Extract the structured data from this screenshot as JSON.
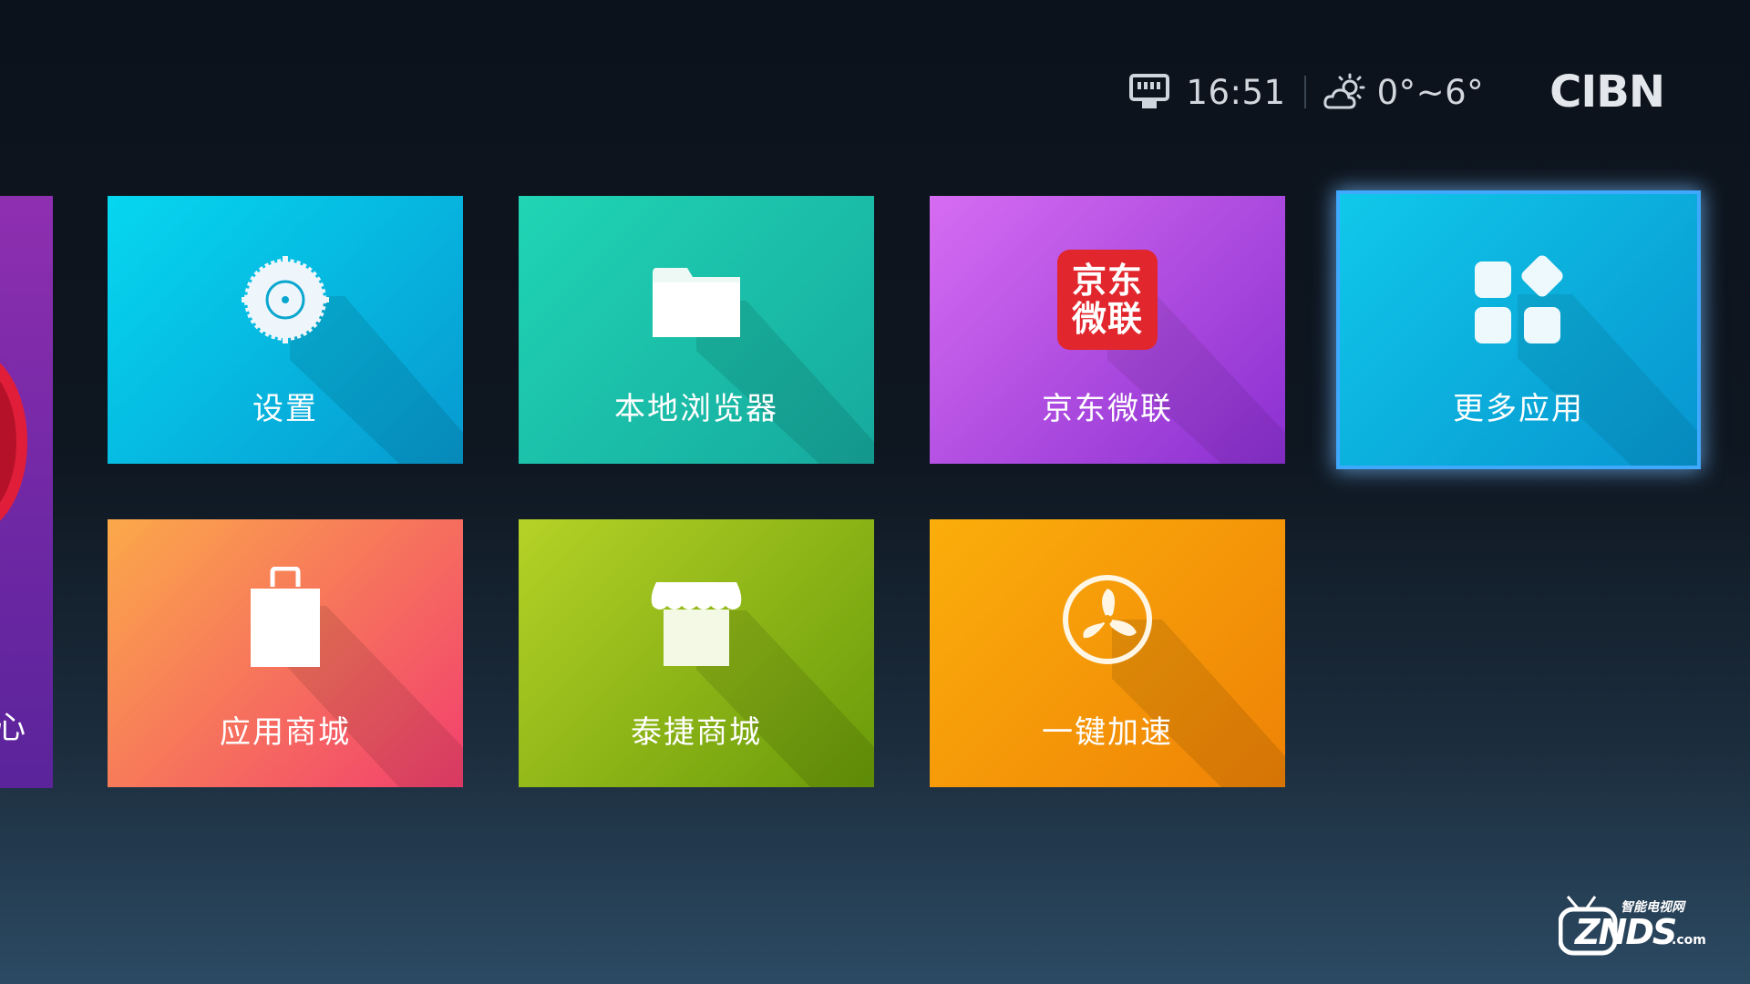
{
  "status": {
    "time": "16:51",
    "temperature": "0°~6°",
    "brand": "CIBN",
    "network_icon": "ethernet-icon",
    "weather_icon": "partly-sunny-icon"
  },
  "partial_tile": {
    "visible_char": "心"
  },
  "tiles": [
    {
      "label": "设置",
      "icon": "settings-gear-icon",
      "color_from": "#06d7f0",
      "color_to": "#0799d0"
    },
    {
      "label": "本地浏览器",
      "icon": "folder-icon",
      "color_from": "#20d5b4",
      "color_to": "#16a99e"
    },
    {
      "label": "京东微联",
      "icon": "jd-weilian-logo",
      "icon_text_line1": "京东",
      "icon_text_line2": "微联",
      "color_from": "#d66cf2",
      "color_to": "#8a2fd0"
    },
    {
      "label": "更多应用",
      "icon": "apps-grid-icon",
      "color_from": "#10c8ea",
      "color_to": "#0795cf",
      "focused": true
    },
    {
      "label": "应用商城",
      "icon": "shopping-bag-icon",
      "color_from": "#fba94a",
      "color_to": "#f23f6e"
    },
    {
      "label": "泰捷商城",
      "icon": "storefront-icon",
      "color_from": "#b5d227",
      "color_to": "#689a09"
    },
    {
      "label": "一键加速",
      "icon": "fan-speed-icon",
      "color_from": "#fbae0b",
      "color_to": "#ef8206"
    }
  ],
  "watermark": {
    "text_top": "智能电视网",
    "text_main": "ZNDS",
    "text_suffix": ".com"
  }
}
